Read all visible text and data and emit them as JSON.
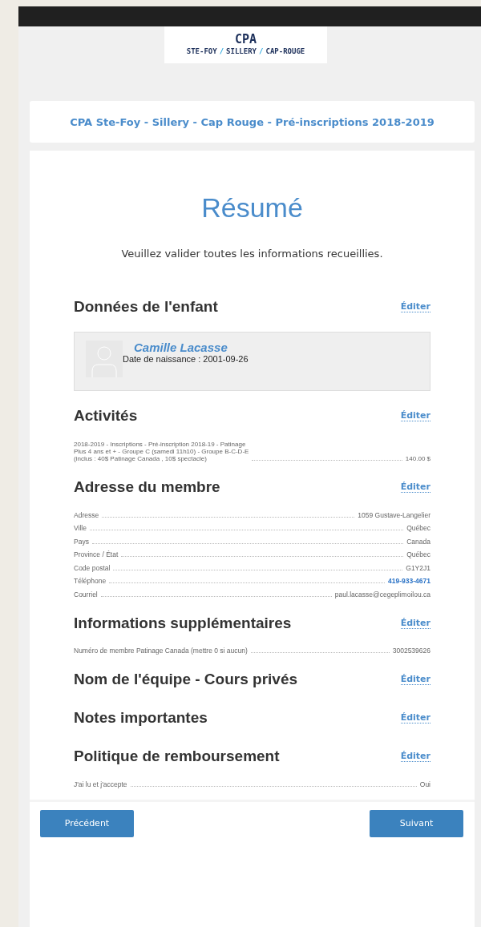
{
  "logo": {
    "title": "CPA",
    "subtitle_parts": [
      "STE-FOY",
      "/",
      "SILLERY",
      "/",
      "CAP-ROUGE"
    ]
  },
  "banner": "CPA Ste-Foy - Sillery - Cap Rouge - Pré-inscriptions 2018-2019",
  "page_title": "Résumé",
  "intro": "Veuillez valider toutes les informations recueillies.",
  "sections": [
    {
      "title": "Données de l'enfant",
      "edit": "Éditer",
      "kind": "profile",
      "name": "Camille Lacasse",
      "birth_label": "Date de naissance :",
      "birth_date": "2001-09-26"
    },
    {
      "title": "Activités",
      "edit": "Éditer",
      "kind": "activity",
      "lines": [
        "2018-2019 - Inscriptions - Pré-inscription 2018-19 - Patinage",
        "Plus 4 ans et + - Groupe C (samedi 11h10) - Groupe B-C-D-E",
        "(inclus : 40$ Patinage Canada , 10$ spectacle)"
      ],
      "amount": "140.00 $"
    },
    {
      "title": "Adresse du membre",
      "edit": "Éditer",
      "kind": "rows",
      "rows": [
        {
          "label": "Adresse",
          "value": "1059 Gustave-Langelier",
          "kind": "text"
        },
        {
          "label": "Ville",
          "value": "Québec",
          "kind": "text"
        },
        {
          "label": "Pays",
          "value": "Canada",
          "kind": "text"
        },
        {
          "label": "Province / État",
          "value": "Québec",
          "kind": "text"
        },
        {
          "label": "Code postal",
          "value": "G1Y2J1",
          "kind": "text"
        },
        {
          "label": "Téléphone",
          "value": "419-933-4671",
          "kind": "link"
        },
        {
          "label": "Courriel",
          "value": "paul.lacasse@cegeplimoilou.ca",
          "kind": "text"
        }
      ]
    },
    {
      "title": "Informations supplémentaires",
      "edit": "Éditer",
      "kind": "rows",
      "rows": [
        {
          "label": "Numéro de membre Patinage Canada (mettre 0 si aucun)",
          "value": "3002539626",
          "kind": "text"
        }
      ]
    },
    {
      "title": "Nom de l'équipe - Cours privés",
      "edit": "Éditer",
      "kind": "rows"
    },
    {
      "title": "Notes importantes",
      "edit": "Éditer",
      "kind": "rows"
    },
    {
      "title": "Politique de remboursement",
      "edit": "Éditer",
      "kind": "rows",
      "rows": [
        {
          "label": "J'ai lu et j'accepte",
          "value": "Oui",
          "kind": "text"
        }
      ]
    }
  ],
  "buttons": {
    "previous": "Précédent",
    "next": "Suivant"
  }
}
